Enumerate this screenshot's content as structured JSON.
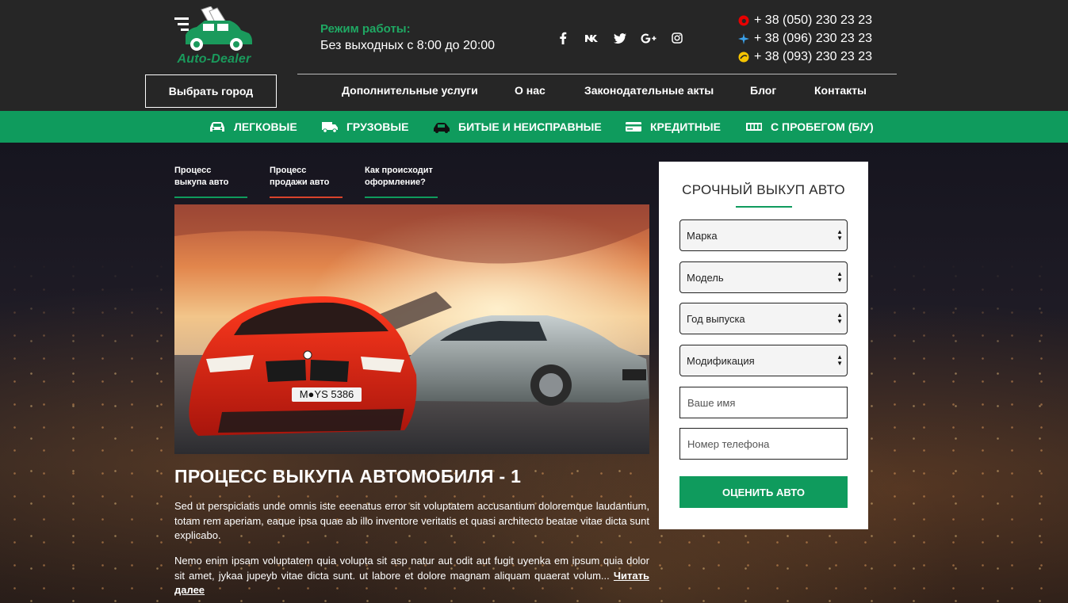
{
  "header": {
    "logo_text": "Auto-Dealer",
    "hours_title": "Режим работы:",
    "hours_text": "Без выходных с 8:00 до 20:00",
    "socials": [
      "f",
      "vk",
      "twitter",
      "G+",
      "instagram"
    ],
    "phones": [
      {
        "operator": "vodafone-icon",
        "number": "+ 38 (050) 230 23 23"
      },
      {
        "operator": "kyivstar-icon",
        "number": "+ 38 (096) 230 23 23"
      },
      {
        "operator": "lifecell-icon",
        "number": "+ 38 (093) 230 23 23"
      }
    ],
    "city_button": "Выбрать город",
    "nav": [
      "Дополнительные услуги",
      "О нас",
      "Законодательные акты",
      "Блог",
      "Контакты"
    ]
  },
  "categories": [
    {
      "icon": "car-icon",
      "label": "ЛЕГКОВЫЕ"
    },
    {
      "icon": "truck-icon",
      "label": "ГРУЗОВЫЕ"
    },
    {
      "icon": "broken-car-icon",
      "label": "БИТЫЕ И НЕИСПРАВНЫЕ"
    },
    {
      "icon": "credit-card-icon",
      "label": "КРЕДИТНЫЕ"
    },
    {
      "icon": "odometer-icon",
      "label": "С ПРОБЕГОМ (Б/У)"
    }
  ],
  "process_tabs": [
    {
      "line1": "Процесс",
      "line2": "выкупа авто",
      "underline": "#0f9b5d"
    },
    {
      "line1": "Процесс",
      "line2": "продажи авто",
      "underline": "#d9432b"
    },
    {
      "line1": "Как происходит",
      "line2": "оформление?",
      "underline": "#0f9b5d"
    }
  ],
  "article": {
    "title": "ПРОЦЕСС ВЫКУПА АВТОМОБИЛЯ - 1",
    "paragraph1": "Sed ut perspiciatis unde omnis iste eeenatus error sit voluptatem accusantium doloremque laudantium, totam rem aperiam, eaque ipsa quae ab illo inventore veritatis et quasi architecto beatae vitae dicta sunt explicabo.",
    "paragraph2": "Nemo enim ipsam voluptatem quia volupta sit asp natur aut odit aut fugit uyenka em ipsum quia dolor sit amet, jykaa jupeyb vitae dicta sunt. ut labore et dolore magnam aliquam quaerat volum...",
    "read_more": "Читать далее",
    "plate_text": "M●YS 5386"
  },
  "form": {
    "title": "СРОЧНЫЙ ВЫКУП АВТО",
    "selects": [
      "Марка",
      "Модель",
      "Год выпуска",
      "Модификация"
    ],
    "name_placeholder": "Ваше имя",
    "phone_placeholder": "Номер телефона",
    "submit": "ОЦЕНИТЬ АВТО"
  },
  "colors": {
    "brand_green": "#0f9b5d",
    "header_bg": "#262626",
    "accent_red": "#d9432b"
  }
}
